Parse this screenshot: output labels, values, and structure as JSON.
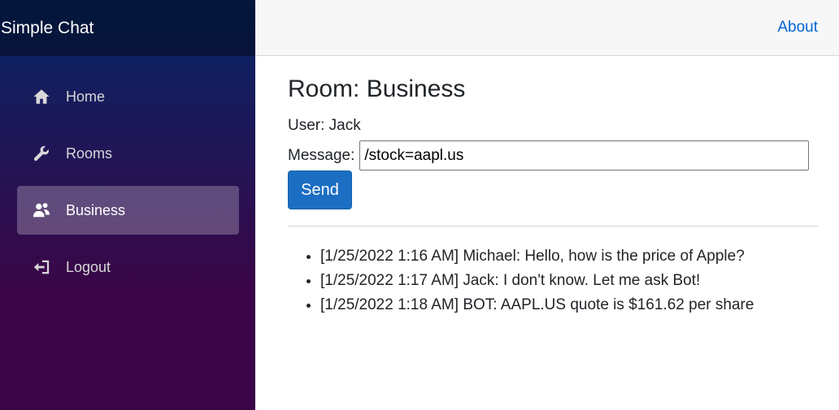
{
  "app": {
    "brand": "Simple Chat"
  },
  "top_bar": {
    "about_label": "About"
  },
  "sidebar": {
    "items": [
      {
        "label": "Home",
        "icon": "home-icon",
        "active": false
      },
      {
        "label": "Rooms",
        "icon": "wrench-icon",
        "active": false
      },
      {
        "label": "Business",
        "icon": "people-icon",
        "active": true
      },
      {
        "label": "Logout",
        "icon": "logout-icon",
        "active": false
      }
    ]
  },
  "room": {
    "title": "Room: Business",
    "user_line": "User: Jack",
    "message_label": "Message:",
    "message_value": "/stock=aapl.us",
    "send_label": "Send"
  },
  "messages": [
    "[1/25/2022 1:16 AM] Michael: Hello, how is the price of Apple?",
    "[1/25/2022 1:17 AM] Jack: I don't know. Let me ask Bot!",
    "[1/25/2022 1:18 AM] BOT: AAPL.US quote is $161.62 per share"
  ],
  "colors": {
    "sidebar_top": "#052767",
    "sidebar_bottom": "#3a0647",
    "link": "#0366d6",
    "primary_button": "#1b6ec2"
  }
}
